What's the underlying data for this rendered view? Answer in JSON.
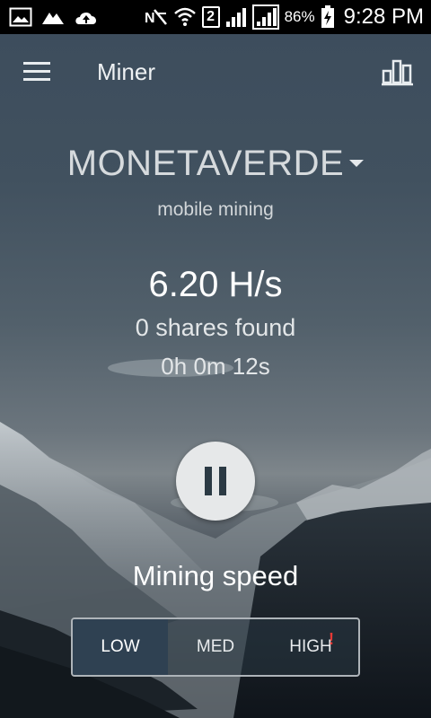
{
  "status_bar": {
    "battery_level": "86%",
    "sim_slot": "2",
    "time": "9:28 PM",
    "icons": [
      "image-icon",
      "mountain-icon",
      "cloud-upload-icon",
      "no-signal-icon",
      "wifi-icon",
      "sim-2-icon",
      "signal-icon",
      "signal-icon-2",
      "battery-charging-icon"
    ]
  },
  "app_bar": {
    "title": "Miner",
    "menu_icon": "hamburger-menu-icon",
    "stats_icon": "bar-chart-icon"
  },
  "main": {
    "coin": "MONETAVERDE",
    "subtitle": "mobile mining",
    "hashrate": "6.20 H/s",
    "shares": "0 shares found",
    "elapsed": "0h 0m 12s",
    "pause_icon": "pause-icon",
    "speed_label": "Mining speed",
    "speed_options": [
      {
        "label": "LOW",
        "selected": true
      },
      {
        "label": "MED",
        "selected": false
      },
      {
        "label": "HIGH",
        "selected": false,
        "badge": "!"
      }
    ]
  },
  "colors": {
    "status_bar_bg": "#000000",
    "pause_button_bg": "#e6e8e9",
    "pause_icon": "#2b3a44",
    "selected_option_bg": "#2f4152",
    "warning": "#e53935"
  }
}
